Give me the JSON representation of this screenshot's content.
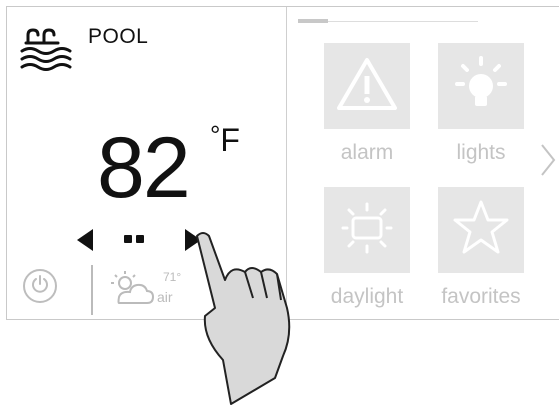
{
  "pool": {
    "label": "POOL"
  },
  "temperature": {
    "value": "82",
    "degree": "°",
    "unit": "F"
  },
  "weather": {
    "temp": "71°",
    "label": "air"
  },
  "tiles": [
    {
      "label": "alarm",
      "icon": "alarm-icon"
    },
    {
      "label": "lights",
      "icon": "lightbulb-icon"
    },
    {
      "label": "daylight",
      "icon": "daylight-icon"
    },
    {
      "label": "favorites",
      "icon": "star-icon"
    }
  ],
  "colors": {
    "tile_bg": "#e6e6e6",
    "tile_label": "#c4c4c4",
    "text": "#111111"
  }
}
